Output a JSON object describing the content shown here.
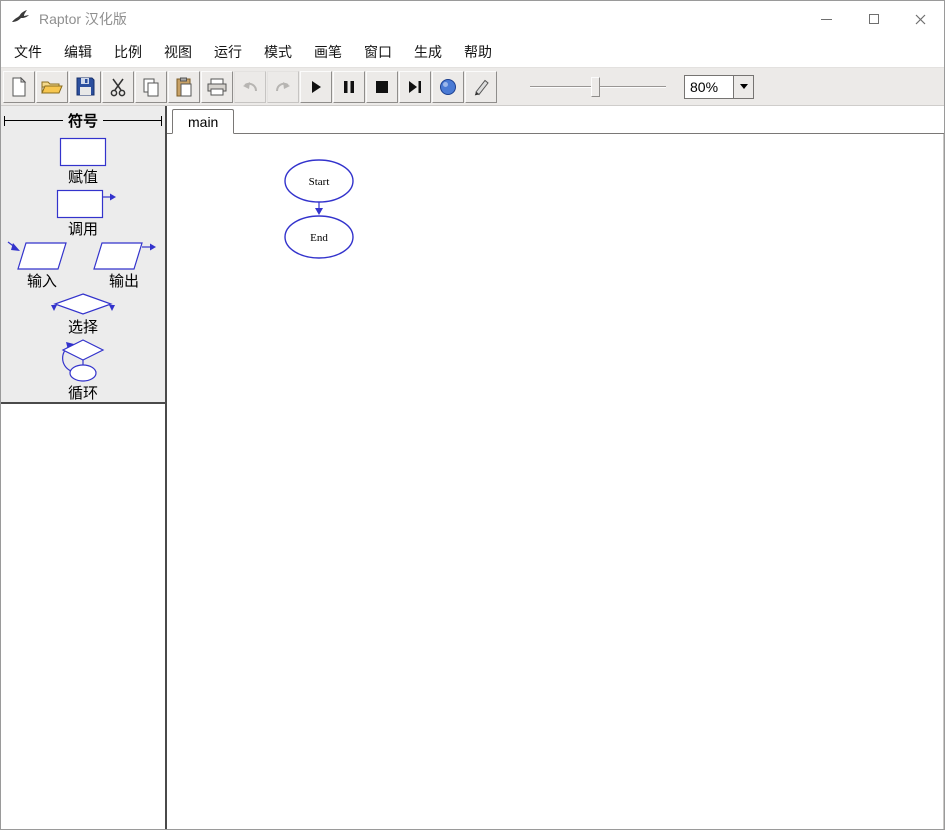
{
  "window": {
    "title": "Raptor 汉化版"
  },
  "menu": {
    "items": [
      {
        "label": "文件"
      },
      {
        "label": "编辑"
      },
      {
        "label": "比例"
      },
      {
        "label": "视图"
      },
      {
        "label": "运行"
      },
      {
        "label": "模式"
      },
      {
        "label": "画笔"
      },
      {
        "label": "窗口"
      },
      {
        "label": "生成"
      },
      {
        "label": "帮助"
      }
    ]
  },
  "toolbar": {
    "buttons": [
      {
        "name": "new"
      },
      {
        "name": "open"
      },
      {
        "name": "save"
      },
      {
        "name": "cut"
      },
      {
        "name": "copy"
      },
      {
        "name": "paste"
      },
      {
        "name": "print"
      },
      {
        "name": "undo",
        "disabled": true
      },
      {
        "name": "redo",
        "disabled": true
      },
      {
        "name": "play"
      },
      {
        "name": "pause"
      },
      {
        "name": "stop"
      },
      {
        "name": "step-to-end"
      },
      {
        "name": "comment"
      },
      {
        "name": "pen"
      }
    ],
    "slider_position_pct": 45,
    "zoom_value": "80%"
  },
  "sidebar": {
    "header": "符号",
    "symbols": [
      {
        "label": "赋值"
      },
      {
        "label": "调用"
      },
      {
        "label": "输入"
      },
      {
        "label": "输出"
      },
      {
        "label": "选择"
      },
      {
        "label": "循环"
      }
    ]
  },
  "main": {
    "tab_label": "main",
    "flowchart": {
      "start_label": "Start",
      "end_label": "End"
    }
  },
  "colors": {
    "symbol_outline": "#3333cc",
    "toolbar_bg": "#eceae8",
    "sidebar_bg": "#ececec",
    "title_text": "#8f8f8f"
  }
}
